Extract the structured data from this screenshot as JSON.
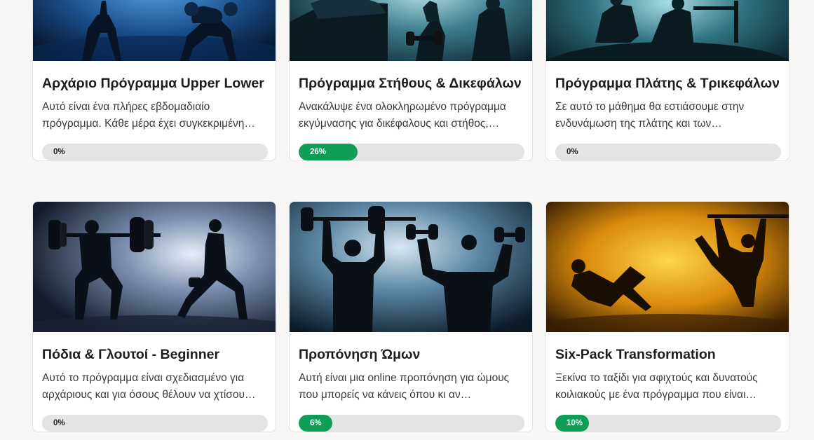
{
  "courses": [
    {
      "title": "Αρχάριο Πρόγραμμα Upper Lower",
      "desc_line1": "Αυτό είναι ένα πλήρες εβδομαδιαίο",
      "desc_line2": "πρόγραμμα. Κάθε μέρα έχει συγκεκριμένη…",
      "progress": 0,
      "progress_label": "0%",
      "theme": "blue"
    },
    {
      "title": "Πρόγραμμα Στήθους & Δικεφάλων",
      "desc_line1": "Ανακάλυψε ένα ολοκληρωμένο πρόγραμμα",
      "desc_line2": "εκγύμνασης για δικέφαλους και στήθος,…",
      "progress": 26,
      "progress_label": "26%",
      "theme": "teal"
    },
    {
      "title": "Πρόγραμμα Πλάτης & Τρικεφάλων",
      "desc_line1": "Σε αυτό το μάθημα θα εστιάσουμε στην",
      "desc_line2": "ενδυνάμωση της πλάτης και των…",
      "progress": 0,
      "progress_label": "0%",
      "theme": "teal"
    },
    {
      "title": "Πόδια & Γλουτοί - Beginner",
      "desc_line1": "Αυτό το πρόγραμμα είναι σχεδιασμένο για",
      "desc_line2": "αρχάριους και για όσους θέλουν να χτίσου…",
      "progress": 0,
      "progress_label": "0%",
      "theme": "slate"
    },
    {
      "title": "Προπόνηση Ώμων",
      "desc_line1": "Αυτή είναι μια online προπόνηση για ώμους",
      "desc_line2": "που μπορείς να κάνεις όπου κι αν…",
      "progress": 6,
      "progress_label": "6%",
      "theme": "steel"
    },
    {
      "title": "Six-Pack Transformation",
      "desc_line1": "Ξεκίνα το ταξίδι για σφιχτούς και δυνατούς",
      "desc_line2": "κοιλιακούς με ένα πρόγραμμα που είναι…",
      "progress": 10,
      "progress_label": "10%",
      "theme": "gold"
    }
  ],
  "colors": {
    "progress_fill": "#0f9d58",
    "progress_track": "#e4e4e4",
    "page_background": "#f7f6f4"
  }
}
